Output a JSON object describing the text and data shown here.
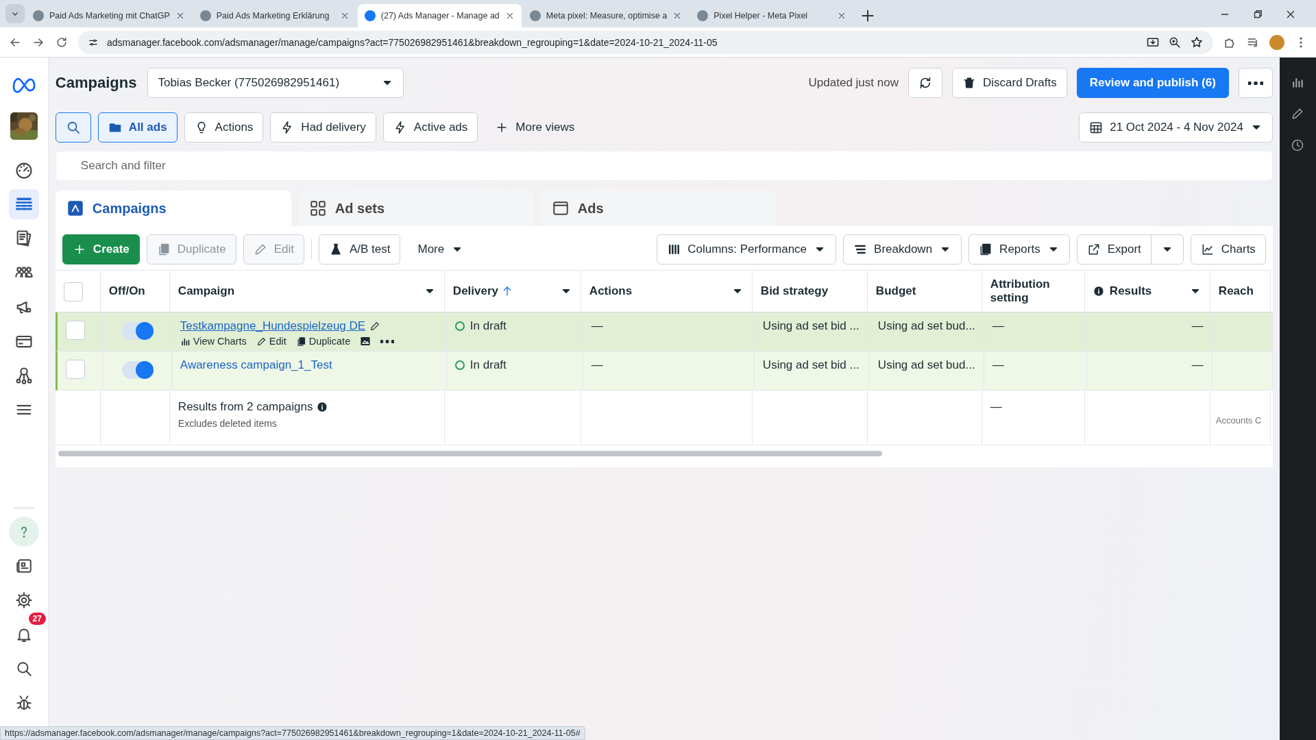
{
  "browser": {
    "tabs": [
      {
        "title": "Paid Ads Marketing mit ChatGP",
        "selected": false
      },
      {
        "title": "Paid Ads Marketing Erklärung",
        "selected": false
      },
      {
        "title": "(27) Ads Manager - Manage ad",
        "selected": true
      },
      {
        "title": "Meta pixel: Measure, optimise a",
        "selected": false
      },
      {
        "title": "Pixel Helper - Meta Pixel",
        "selected": false
      }
    ],
    "url": "adsmanager.facebook.com/adsmanager/manage/campaigns?act=775026982951461&breakdown_regrouping=1&date=2024-10-21_2024-11-05"
  },
  "left_rail": {
    "items": [
      {
        "selected": false
      },
      {
        "selected": true
      },
      {
        "selected": false
      },
      {
        "selected": false
      },
      {
        "selected": false
      },
      {
        "selected": false
      },
      {
        "selected": false
      },
      {
        "selected": false
      }
    ],
    "bottom_items": [
      {
        "selected": true
      },
      {
        "selected": false
      },
      {
        "selected": false
      },
      {
        "selected": false,
        "badge": "27"
      },
      {
        "selected": false
      },
      {
        "selected": false
      }
    ]
  },
  "header": {
    "title": "Campaigns",
    "account": "Tobias Becker (775026982951461)",
    "updated": "Updated just now",
    "discard": "Discard Drafts",
    "publish": "Review and publish (6)"
  },
  "views": [
    {
      "label": "All ads",
      "selected": true
    },
    {
      "label": "Actions",
      "selected": false
    },
    {
      "label": "Had delivery",
      "selected": false
    },
    {
      "label": "Active ads",
      "selected": false
    }
  ],
  "more_views": "More views",
  "date_range": "21 Oct 2024 - 4 Nov 2024",
  "search": {
    "placeholder": "Search and filter"
  },
  "level_tabs": [
    {
      "label": "Campaigns",
      "selected": true
    },
    {
      "label": "Ad sets",
      "selected": false
    },
    {
      "label": "Ads",
      "selected": false
    }
  ],
  "toolbar": {
    "create": "Create",
    "left": [
      {
        "label": "Duplicate",
        "disabled": true
      },
      {
        "label": "Edit",
        "disabled": true
      },
      {
        "label": "A/B test",
        "disabled": false
      }
    ],
    "more": "More",
    "right": [
      "Columns: Performance",
      "Breakdown",
      "Reports",
      "Export",
      "Charts"
    ]
  },
  "table": {
    "select_all_checked": false,
    "columns": [
      {
        "label": "Off/On",
        "menu": false,
        "sorted": false
      },
      {
        "label": "Campaign",
        "menu": true,
        "sorted": false
      },
      {
        "label": "Delivery",
        "menu": true,
        "sorted": true
      },
      {
        "label": "Actions",
        "menu": true,
        "sorted": false
      },
      {
        "label": "Bid strategy",
        "menu": false,
        "sorted": false
      },
      {
        "label": "Budget",
        "menu": false,
        "sorted": false
      },
      {
        "label": "Attribution setting",
        "menu": false,
        "sorted": false
      },
      {
        "label": "Results",
        "menu": true,
        "sorted": false
      },
      {
        "label": "Reach",
        "menu": false,
        "sorted": false
      }
    ],
    "rows": [
      {
        "checked": false,
        "on": true,
        "hovered": true,
        "name": "Testkampagne_Hundespielzeug DE",
        "row_actions": [
          "View Charts",
          "Edit",
          "Duplicate"
        ],
        "delivery": "In draft",
        "actions": "—",
        "bid_strategy": "Using ad set bid ...",
        "budget": "Using ad set bud...",
        "attribution": "—",
        "results": "—"
      },
      {
        "checked": false,
        "on": true,
        "hovered": false,
        "name": "Awareness campaign_1_Test",
        "delivery": "In draft",
        "actions": "—",
        "bid_strategy": "Using ad set bid ...",
        "budget": "Using ad set bud...",
        "attribution": "—",
        "results": "—"
      }
    ],
    "summary": {
      "title": "Results from 2 campaigns",
      "note": "Excludes deleted items",
      "attribution": "—",
      "reach": "Accounts C"
    }
  },
  "status_url": "https://adsmanager.facebook.com/adsmanager/manage/campaigns?act=775026982951461&breakdown_regrouping=1&date=2024-10-21_2024-11-05#"
}
